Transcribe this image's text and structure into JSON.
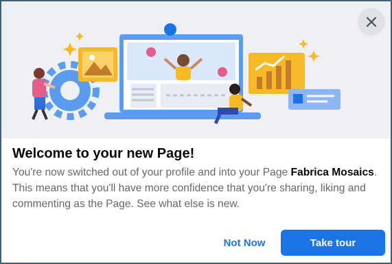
{
  "dialog": {
    "title": "Welcome to your new Page!",
    "body_before": "You're now switched out of your profile and into your Page ",
    "page_name": "Fabrica Mosaics",
    "body_after": ". This means that you'll have more confidence that you're sharing, liking and commenting as the Page. See what else is new.",
    "close_icon": "close-icon",
    "buttons": {
      "secondary_label": "Not Now",
      "primary_label": "Take tour"
    }
  },
  "colors": {
    "accent": "#1b74e4",
    "hero_bg": "#eef0f4",
    "border": "#3b5f7f",
    "title": "#050505",
    "body": "#65676b"
  }
}
